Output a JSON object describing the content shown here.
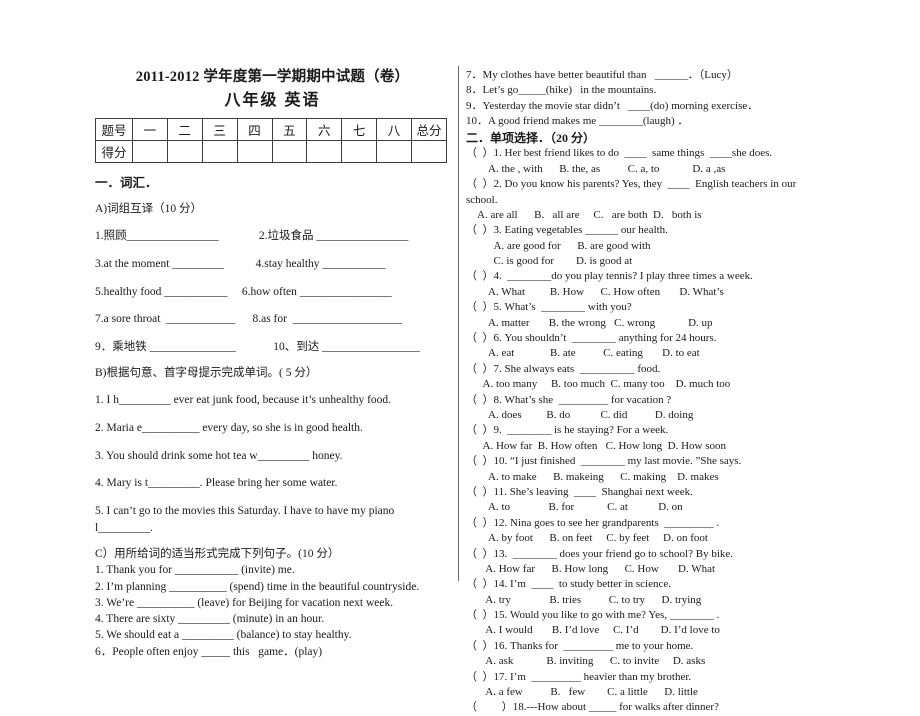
{
  "header": {
    "title": "2011-2012 学年度第一学期期中试题（卷）",
    "subtitle": "八年级    英语"
  },
  "score_table": {
    "row_labels": [
      "题号",
      "得分"
    ],
    "columns": [
      "一",
      "二",
      "三",
      "四",
      "五",
      "六",
      "七",
      "八",
      "总分"
    ],
    "values_row": [
      "",
      "",
      "",
      "",
      "",
      "",
      "",
      "",
      ""
    ]
  },
  "left": {
    "section_one_title": "一．词汇．",
    "part_a": {
      "heading": "A)词组互译（10 分）",
      "items": [
        "1.照顾________________              2.垃圾食品 ________________",
        "3.at the moment _________           4.stay healthy ___________",
        "5.healthy food ___________     6.how often ________________",
        "7.a sore throat  ____________      8.as for  ___________________",
        "9．乘地铁 _______________             10、到达 _________________"
      ]
    },
    "part_b": {
      "heading": "B)根据句意、首字母提示完成单词。( 5 分）",
      "items": [
        "1. I h_________ ever eat junk food, because it’s unhealthy food.",
        "2. Maria e__________ every day, so she is in good health.",
        "3. You should drink some hot tea w_________ honey.",
        "4. Mary is t_________. Please bring her some water.",
        "5. I can’t go to the movies this Saturday. I have to have my piano l_________."
      ]
    },
    "part_c": {
      "heading": "C）用所给词的适当形式完成下列句子。(10 分）",
      "items": [
        "1. Thank you for ___________ (invite) me.",
        "2. I’m planning __________ (spend) time in the beautiful countryside.",
        "3. We’re __________ (leave) for Beijing for vacation next week.",
        "4. There are sixty _________ (minute) in an hour.",
        "5. We should eat a _________ (balance) to stay healthy.",
        "6．People often enjoy _____ this   game．(play)"
      ]
    }
  },
  "right": {
    "carryover_items": [
      "7．My clothes have better beautiful than   ______．（Lucy）",
      "8．Let’s go_____(hike)   in the mountains.",
      "9．Yesterday the movie star didn’t   ____(do) morning exercise．",
      "10．A good friend makes me ________(laugh) ．"
    ],
    "section_two_title": "二．单项选择．（20 分）",
    "questions": [
      {
        "stem": "（  ）1. Her best friend likes to do  ____  same things  ____she does.",
        "options": [
          "        A. the , with      B. the, as          C. a, to            D. a ,as"
        ]
      },
      {
        "stem": "（  ）2. Do you know his parents? Yes, they  ____  English teachers in our school.",
        "options": [
          "    A. are all      B.   all are     C.   are both  D.   both is"
        ]
      },
      {
        "stem": "（  ）3. Eating vegetables ______ our health.",
        "options": [
          "          A. are good for      B. are good with",
          "          C. is good for        D. is good at"
        ]
      },
      {
        "stem": "（  ）4.  ________do you play tennis? I play three times a week.",
        "options": [
          "        A. What         B. How      C. How often       D. What’s"
        ]
      },
      {
        "stem": "（  ）5. What’s  ________ with you?",
        "options": [
          "        A. matter       B. the wrong   C. wrong            D. up"
        ]
      },
      {
        "stem": "（  ）6. You shouldn’t  ________ anything for 24 hours.",
        "options": [
          "        A. eat             B. ate          C. eating       D. to eat"
        ]
      },
      {
        "stem": "（  ）7. She always eats  __________ food.",
        "options": [
          "      A. too many     B. too much  C. many too    D. much too"
        ]
      },
      {
        "stem": "（  ）8. What’s she  _________ for vacation ?",
        "options": [
          "        A. does         B. do           C. did          D. doing"
        ]
      },
      {
        "stem": "（  ）9.  ________ is he staying? For a week.",
        "options": [
          "      A. How far  B. How often   C. How long  D. How soon"
        ]
      },
      {
        "stem": "（  ）10. “I just finished  ________ my last movie. ”She says.",
        "options": [
          "        A. to make      B. makeing      C. making    D. makes"
        ]
      },
      {
        "stem": "（  ）11. She’s leaving  ____  Shanghai next week.",
        "options": [
          "        A. to              B. for            C. at           D. on"
        ]
      },
      {
        "stem": "（  ）12. Nina goes to see her grandparents  _________ .",
        "options": [
          "        A. by foot      B. on feet     C. by feet     D. on foot"
        ]
      },
      {
        "stem": "（  ）13.  ________ does your friend go to school? By bike.",
        "options": [
          "       A. How far      B. How long      C. How       D. What"
        ]
      },
      {
        "stem": "（  ）14. I’m  ____  to study better in science.",
        "options": [
          "       A. try              B. tries          C. to try      D. trying"
        ]
      },
      {
        "stem": "（  ）15. Would you like to go with me? Yes, ________ .",
        "options": [
          "       A. I would       B. I’d love     C. I’d        D. I’d love to"
        ]
      },
      {
        "stem": "（  ）16. Thanks for  _________ me to your home.",
        "options": [
          "       A. ask            B. inviting      C. to invite     D. asks"
        ]
      },
      {
        "stem": "（  ）17. I’m  _________ heavier than my brother.",
        "options": [
          "       A. a few          B.   few        C. a little      D. little"
        ]
      },
      {
        "stem": "（         ）18.---How about _____ for walks after dinner?",
        "options": []
      }
    ]
  }
}
